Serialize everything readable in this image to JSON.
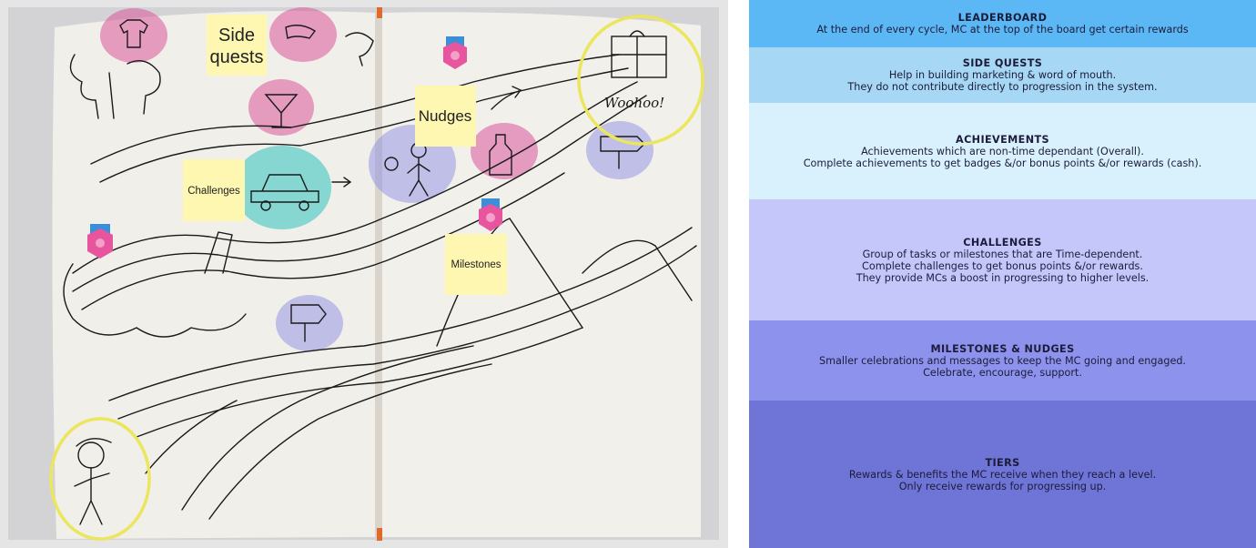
{
  "photo": {
    "notes": {
      "side_quests_line1": "Side",
      "side_quests_line2": "quests",
      "nudges": "Nudges",
      "challenges": "Challenges",
      "milestones": "Milestones"
    },
    "sketch_text": "Woohoo!"
  },
  "panels": [
    {
      "title": "LEADERBOARD",
      "lines": [
        "At the end of every cycle, MC at the top of the board get certain rewards"
      ]
    },
    {
      "title": "SIDE QUESTS",
      "lines": [
        "Help in building marketing & word of mouth.",
        "They do not contribute directly to progression in the system."
      ]
    },
    {
      "title": "ACHIEVEMENTS",
      "lines": [
        "Achievements which are non-time dependant (Overall).",
        "Complete achievements to get badges &/or bonus points &/or rewards (cash)."
      ]
    },
    {
      "title": "CHALLENGES",
      "lines": [
        "Group of tasks or milestones that are Time-dependent.",
        "Complete challenges to get bonus points &/or rewards.",
        "They provide MCs a boost in progressing to higher levels."
      ]
    },
    {
      "title": "MILESTONES & NUDGES",
      "lines": [
        "Smaller celebrations and messages to keep the MC going and engaged.",
        "Celebrate, encourage, support."
      ]
    },
    {
      "title": "TIERS",
      "lines": [
        "Rewards & benefits the MC receive when they reach a level.",
        "Only receive rewards for progressing up."
      ]
    }
  ]
}
